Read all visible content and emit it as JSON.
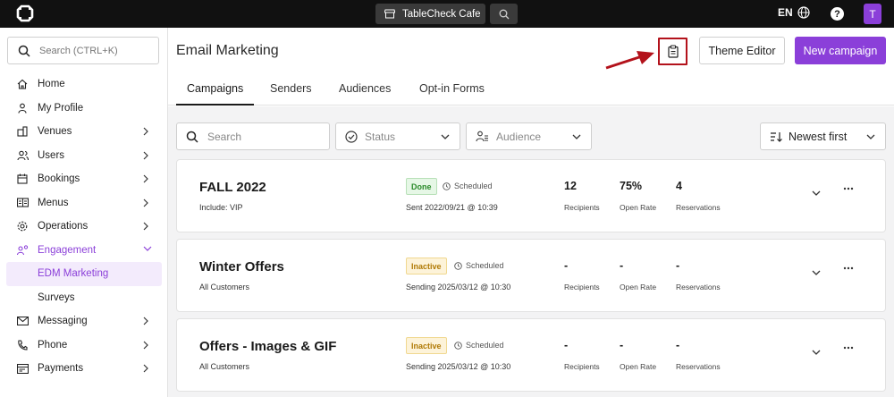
{
  "topbar": {
    "venue": "TableCheck Cafe",
    "language": "EN",
    "help": "?",
    "avatar_initial": "T"
  },
  "sidebar": {
    "search_placeholder": "Search (CTRL+K)",
    "items": [
      {
        "label": "Home",
        "icon": "home-icon",
        "chevron": false
      },
      {
        "label": "My Profile",
        "icon": "person-icon",
        "chevron": false
      },
      {
        "label": "Venues",
        "icon": "venue-icon",
        "chevron": true
      },
      {
        "label": "Users",
        "icon": "users-icon",
        "chevron": true
      },
      {
        "label": "Bookings",
        "icon": "calendar-icon",
        "chevron": true
      },
      {
        "label": "Menus",
        "icon": "menu-book-icon",
        "chevron": true
      },
      {
        "label": "Operations",
        "icon": "operations-icon",
        "chevron": true
      },
      {
        "label": "Engagement",
        "icon": "engagement-icon",
        "chevron": true,
        "expanded": true
      },
      {
        "label": "EDM Marketing",
        "sub": true,
        "selected": true
      },
      {
        "label": "Surveys",
        "sub": true
      },
      {
        "label": "Messaging",
        "icon": "mail-icon",
        "chevron": true
      },
      {
        "label": "Phone",
        "icon": "phone-icon",
        "chevron": true
      },
      {
        "label": "Payments",
        "icon": "payments-icon",
        "chevron": true
      }
    ]
  },
  "main": {
    "title": "Email Marketing",
    "theme_editor": "Theme Editor",
    "new_campaign": "New campaign",
    "tabs": [
      "Campaigns",
      "Senders",
      "Audiences",
      "Opt-in Forms"
    ],
    "filters": {
      "search_placeholder": "Search",
      "status": "Status",
      "audience": "Audience",
      "sort": "Newest first"
    }
  },
  "campaigns": [
    {
      "title": "FALL 2022",
      "audience": "Include: VIP",
      "status": "Done",
      "schedule": "Scheduled",
      "date": "Sent 2022/09/21 @ 10:39",
      "recipients": "12",
      "open_rate": "75%",
      "reservations": "4"
    },
    {
      "title": "Winter Offers",
      "audience": "All Customers",
      "status": "Inactive",
      "schedule": "Scheduled",
      "date": "Sending 2025/03/12 @ 10:30",
      "recipients": "-",
      "open_rate": "-",
      "reservations": "-"
    },
    {
      "title": "Offers - Images & GIF",
      "audience": "All Customers",
      "status": "Inactive",
      "schedule": "Scheduled",
      "date": "Sending 2025/03/12 @ 10:30",
      "recipients": "-",
      "open_rate": "-",
      "reservations": "-"
    }
  ],
  "stat_labels": {
    "recipients": "Recipients",
    "open_rate": "Open Rate",
    "reservations": "Reservations"
  },
  "colors": {
    "accent": "#8b3fd9",
    "highlight_box": "#b3121b",
    "done": "#2a8a2a",
    "inactive": "#b07a06"
  }
}
